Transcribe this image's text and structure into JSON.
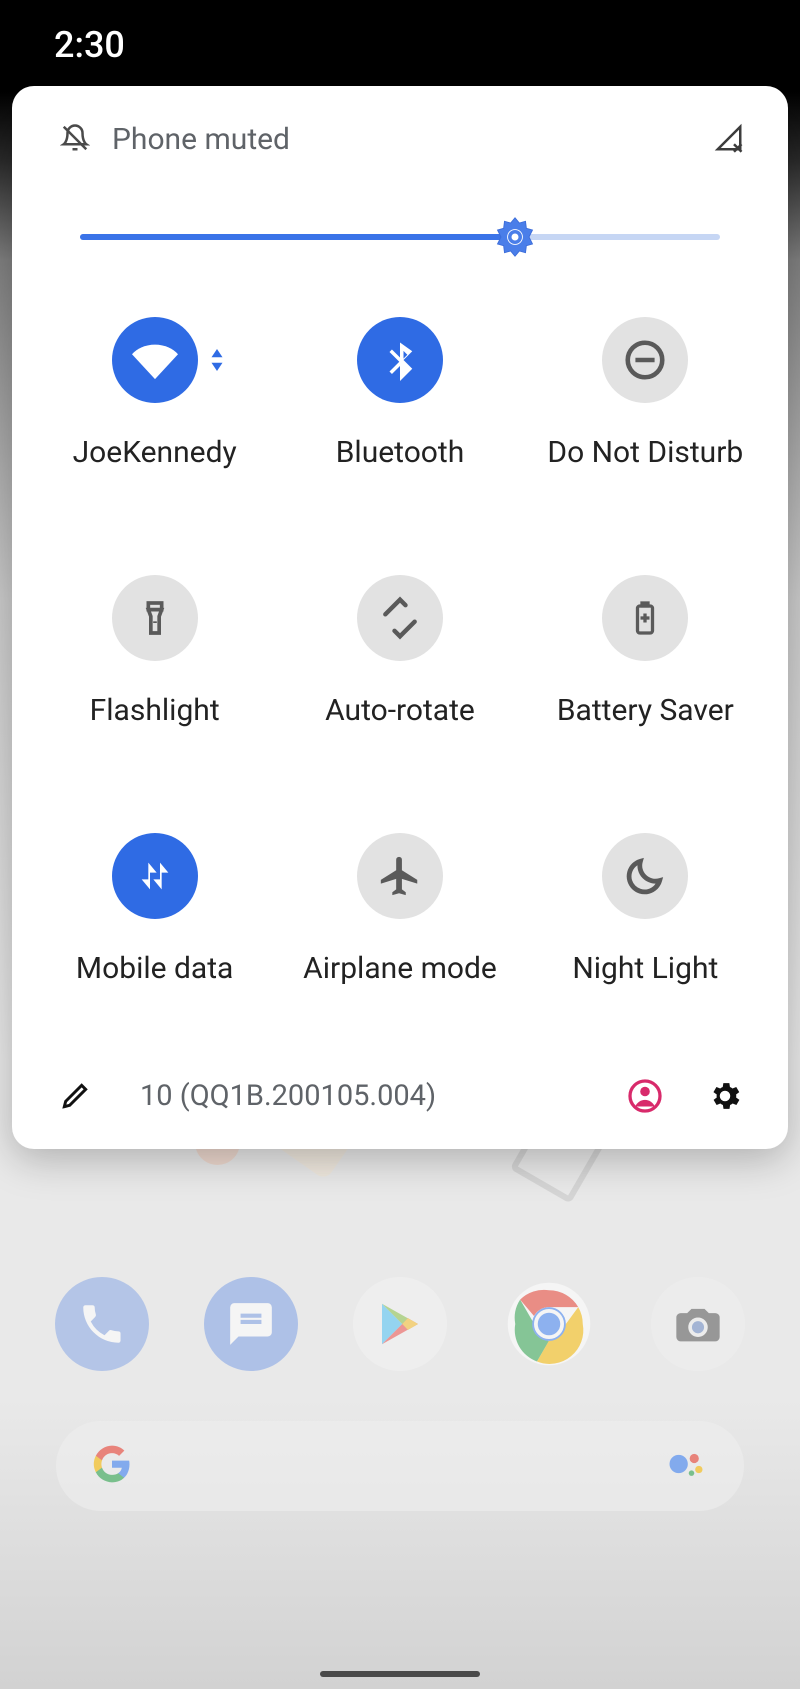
{
  "status": {
    "time": "2:30"
  },
  "header": {
    "muted_text": "Phone muted"
  },
  "brightness": {
    "percent": 68
  },
  "tiles": [
    {
      "key": "wifi",
      "label": "JoeKennedy",
      "active": true,
      "icon": "wifi",
      "expandable": true
    },
    {
      "key": "bluetooth",
      "label": "Bluetooth",
      "active": true,
      "icon": "bluetooth",
      "expandable": false
    },
    {
      "key": "dnd",
      "label": "Do Not Disturb",
      "active": false,
      "icon": "dnd",
      "expandable": false
    },
    {
      "key": "flashlight",
      "label": "Flashlight",
      "active": false,
      "icon": "flashlight",
      "expandable": false
    },
    {
      "key": "autorotate",
      "label": "Auto-rotate",
      "active": false,
      "icon": "rotate",
      "expandable": false
    },
    {
      "key": "batterysaver",
      "label": "Battery Saver",
      "active": false,
      "icon": "battery",
      "expandable": false
    },
    {
      "key": "mobiledata",
      "label": "Mobile data",
      "active": true,
      "icon": "data",
      "expandable": false
    },
    {
      "key": "airplane",
      "label": "Airplane mode",
      "active": false,
      "icon": "airplane",
      "expandable": false
    },
    {
      "key": "nightlight",
      "label": "Night Light",
      "active": false,
      "icon": "moon",
      "expandable": false
    }
  ],
  "footer": {
    "build": "10 (QQ1B.200105.004)"
  },
  "dock": {
    "apps": [
      {
        "key": "phone",
        "name": "Phone"
      },
      {
        "key": "messages",
        "name": "Messages"
      },
      {
        "key": "play",
        "name": "Play Store"
      },
      {
        "key": "chrome",
        "name": "Chrome"
      },
      {
        "key": "camera",
        "name": "Camera"
      }
    ]
  }
}
